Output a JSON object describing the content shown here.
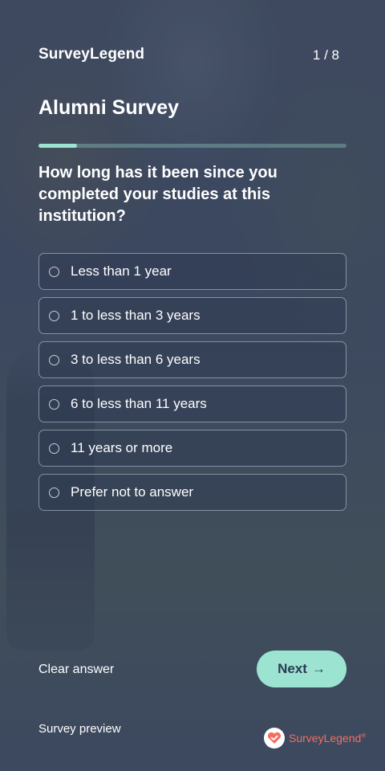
{
  "header": {
    "brand": "SurveyLegend",
    "page_count": "1 / 8"
  },
  "survey": {
    "title": "Alumni Survey",
    "progress_fraction": 0.125,
    "question": "How long has it been since you completed your studies at this institution?",
    "options": [
      "Less than 1 year",
      "1 to less than 3 years",
      "3 to less than 6 years",
      "6 to less than 11 years",
      "11 years or more",
      "Prefer not to answer"
    ]
  },
  "actions": {
    "clear_label": "Clear answer",
    "next_label": "Next",
    "next_arrow": "→"
  },
  "footer": {
    "preview_label": "Survey preview",
    "logo_text": "SurveyLegend",
    "logo_mark": "®"
  },
  "colors": {
    "accent": "#9de3d2",
    "brand_logo": "#f26f5e"
  },
  "icons": {
    "next": "arrow-right-icon",
    "logo": "heart-check-icon"
  }
}
